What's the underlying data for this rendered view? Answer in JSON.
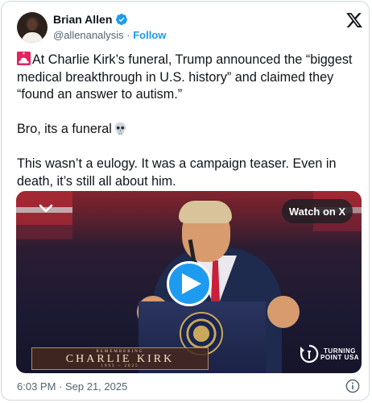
{
  "author": {
    "name": "Brian Allen",
    "handle": "@allenanalysis",
    "separator": "·",
    "follow_label": "Follow"
  },
  "tweet": {
    "text_1": "At Charlie Kirk’s funeral, Trump announced the “biggest medical breakthrough in U.S. history” and claimed they “found an answer to autism.”",
    "text_2": "Bro, its a funeral",
    "text_3": "This wasn’t a eulogy. It was a campaign teaser. Even in death, it’s still all about him."
  },
  "media": {
    "watch_label": "Watch on X",
    "banner_remembering": "REMEMBERING",
    "banner_name": "CHARLIE KIRK",
    "banner_years": "1993 – 2025",
    "logo_line1": "TURNING",
    "logo_line2": "POINT USA"
  },
  "timestamp": "6:03 PM · Sep 21, 2025",
  "icons": {
    "verified": "verified-badge-icon",
    "x": "x-logo-icon",
    "alert": "rotating-light-icon",
    "skull": "skull-icon",
    "collapse": "chevron-down-icon",
    "play": "play-icon",
    "info": "info-icon"
  },
  "colors": {
    "link": "#1d9bf0",
    "muted": "#536471",
    "text": "#0f1419"
  }
}
